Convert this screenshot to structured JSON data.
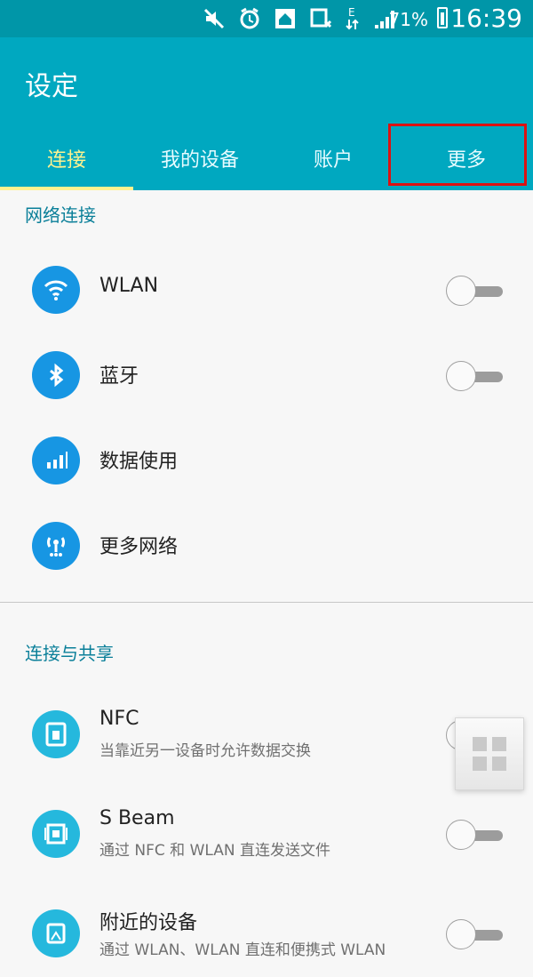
{
  "statusbar": {
    "battery": "71%",
    "time": "16:39"
  },
  "header": {
    "title": "设定",
    "tabs": [
      {
        "label": "连接"
      },
      {
        "label": "我的设备"
      },
      {
        "label": "账户"
      },
      {
        "label": "更多"
      }
    ]
  },
  "sections": {
    "network": {
      "title": "网络连接",
      "items": [
        {
          "label": "WLAN",
          "icon": "wifi-icon"
        },
        {
          "label": "蓝牙",
          "icon": "bluetooth-icon"
        },
        {
          "label": "数据使用",
          "icon": "data-usage-icon"
        },
        {
          "label": "更多网络",
          "icon": "more-networks-icon"
        }
      ]
    },
    "connect_share": {
      "title": "连接与共享",
      "items": [
        {
          "label": "NFC",
          "subtitle": "当靠近另一设备时允许数据交换",
          "icon": "nfc-icon"
        },
        {
          "label": "S Beam",
          "subtitle": "通过 NFC 和 WLAN 直连发送文件",
          "icon": "s-beam-icon"
        },
        {
          "label": "附近的设备",
          "subtitle": "通过 WLAN、WLAN 直连和便携式 WLAN",
          "icon": "nearby-devices-icon"
        }
      ]
    }
  },
  "colors": {
    "status": "#0096a8",
    "appbar": "#00a8c0",
    "active_tab": "#fff28f",
    "highlight": "#d11111"
  }
}
